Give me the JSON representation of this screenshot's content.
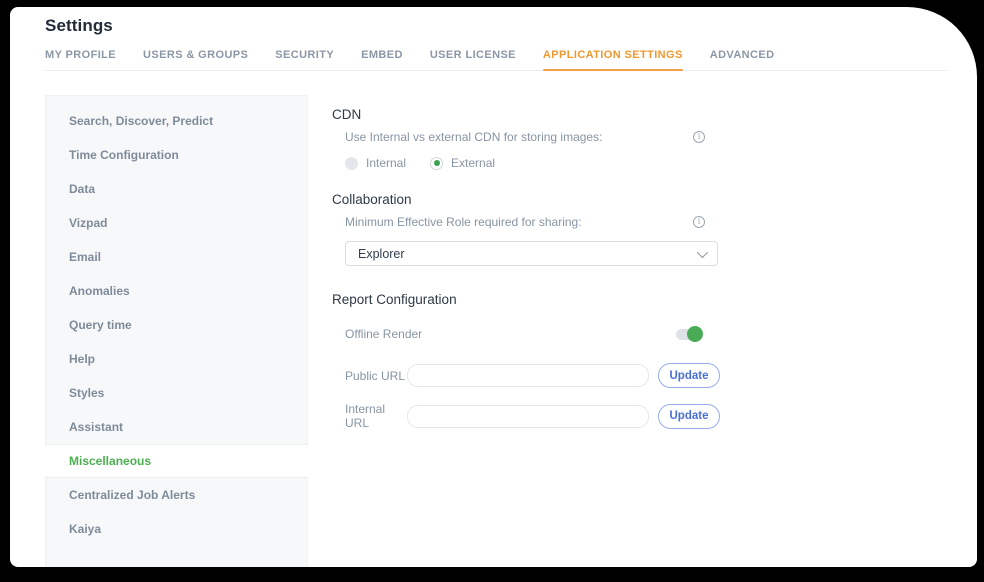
{
  "window": {
    "title": "Settings"
  },
  "tabs": [
    {
      "label": "MY PROFILE",
      "active": false
    },
    {
      "label": "USERS & GROUPS",
      "active": false
    },
    {
      "label": "SECURITY",
      "active": false
    },
    {
      "label": "EMBED",
      "active": false
    },
    {
      "label": "USER LICENSE",
      "active": false
    },
    {
      "label": "APPLICATION SETTINGS",
      "active": true
    },
    {
      "label": "ADVANCED",
      "active": false
    }
  ],
  "sidebar": {
    "items": [
      {
        "label": "Search, Discover, Predict",
        "active": false
      },
      {
        "label": "Time Configuration",
        "active": false
      },
      {
        "label": "Data",
        "active": false
      },
      {
        "label": "Vizpad",
        "active": false
      },
      {
        "label": "Email",
        "active": false
      },
      {
        "label": "Anomalies",
        "active": false
      },
      {
        "label": "Query time",
        "active": false
      },
      {
        "label": "Help",
        "active": false
      },
      {
        "label": "Styles",
        "active": false
      },
      {
        "label": "Assistant",
        "active": false
      },
      {
        "label": "Miscellaneous",
        "active": true
      },
      {
        "label": "Centralized Job Alerts",
        "active": false
      },
      {
        "label": "Kaiya",
        "active": false
      }
    ]
  },
  "main": {
    "cdn": {
      "heading": "CDN",
      "description": "Use Internal vs external CDN for storing images:",
      "options": [
        {
          "label": "Internal",
          "selected": false
        },
        {
          "label": "External",
          "selected": true
        }
      ]
    },
    "collaboration": {
      "heading": "Collaboration",
      "description": "Minimum Effective Role required for sharing:",
      "selected_role": "Explorer"
    },
    "report": {
      "heading": "Report Configuration",
      "offline_render_label": "Offline Render",
      "offline_render_on": true,
      "public_url_label": "Public URL",
      "public_url_value": "",
      "internal_url_label": "Internal URL",
      "internal_url_value": "",
      "update_label": "Update"
    }
  },
  "colors": {
    "accent_orange": "#F0982E",
    "accent_green": "#4CAF50",
    "accent_blue": "#4A6FD8",
    "sidebar_bg": "#F7F8FA",
    "text_gray": "#8795A3",
    "text_dark": "#222B38"
  }
}
